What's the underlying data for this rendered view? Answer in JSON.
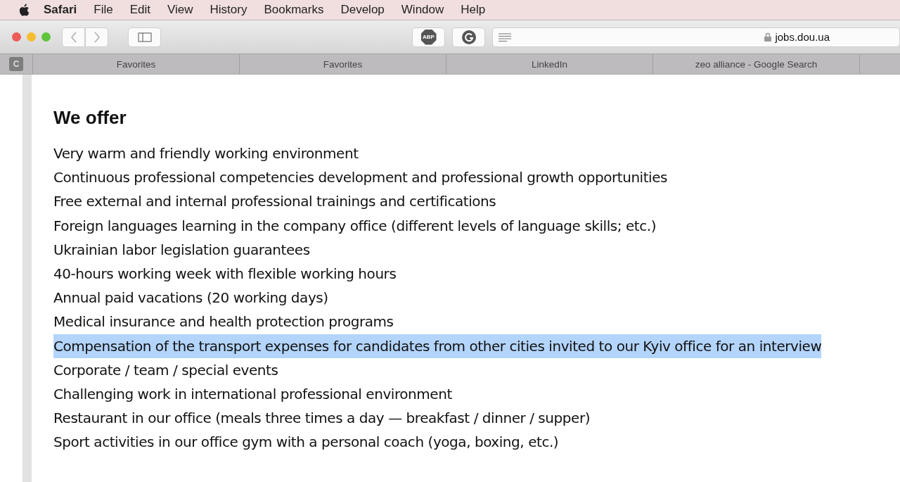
{
  "menu_bar": {
    "app": "Safari",
    "items": [
      "File",
      "Edit",
      "View",
      "History",
      "Bookmarks",
      "Develop",
      "Window",
      "Help"
    ]
  },
  "toolbar": {
    "adblock_label": "ABP",
    "address": "jobs.dou.ua"
  },
  "tab_bar": {
    "badge": "C",
    "tabs": [
      {
        "label": "Favorites",
        "selected": false
      },
      {
        "label": "Favorites",
        "selected": false
      },
      {
        "label": "LinkedIn",
        "selected": false
      },
      {
        "label": "zeo alliance - Google Search",
        "selected": false
      }
    ]
  },
  "content": {
    "heading": "We offer",
    "items": [
      {
        "text": "Very warm and friendly working environment",
        "selected": false
      },
      {
        "text": "Continuous professional competencies development and professional growth opportunities",
        "selected": false
      },
      {
        "text": "Free external and internal professional trainings and certifications",
        "selected": false
      },
      {
        "text": "Foreign languages learning in the company office (different levels of language skills; etc.)",
        "selected": false
      },
      {
        "text": "Ukrainian labor legislation guarantees",
        "selected": false
      },
      {
        "text": "40-hours working week with flexible working hours",
        "selected": false
      },
      {
        "text": "Annual paid vacations (20 working days)",
        "selected": false
      },
      {
        "text": "Medical insurance and health protection programs",
        "selected": false
      },
      {
        "text": "Compensation of the transport expenses for candidates from other cities invited to our Kyiv office for an interview",
        "selected": true
      },
      {
        "text": "Corporate / team / special events",
        "selected": false
      },
      {
        "text": "Challenging work in international professional environment",
        "selected": false
      },
      {
        "text": "Restaurant in our office (meals three times a day — breakfast / dinner / supper)",
        "selected": false
      },
      {
        "text": "Sport activities in our office gym with a personal coach (yoga, boxing, etc.)",
        "selected": false
      }
    ]
  }
}
